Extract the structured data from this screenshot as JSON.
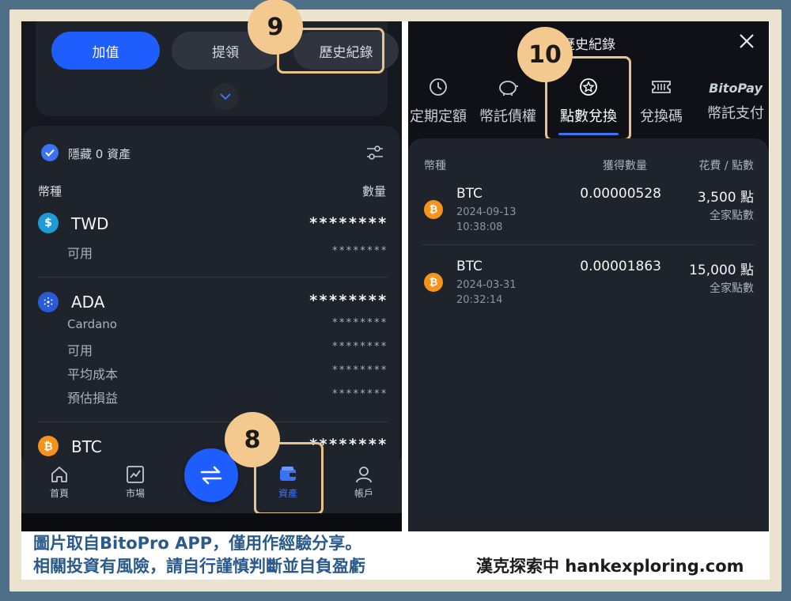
{
  "left_screen": {
    "buttons": {
      "deposit": "加值",
      "withdraw": "提領",
      "history": "歷史紀錄"
    },
    "hide_zero": "隱藏 0 資產",
    "columns": {
      "coin": "幣種",
      "amount": "數量"
    },
    "assets": [
      {
        "symbol": "TWD",
        "icon": "dollar-icon",
        "color": "#1e9bd7",
        "masked": "********",
        "details": [
          {
            "label": "可用",
            "value": "********"
          }
        ]
      },
      {
        "symbol": "ADA",
        "icon": "cardano-icon",
        "color": "#2a5bd7",
        "masked": "********",
        "full_name": "Cardano",
        "details": [
          {
            "label": "可用",
            "value": "********"
          },
          {
            "label": "平均成本",
            "value": "********"
          },
          {
            "label": "預估損益",
            "value": "********"
          }
        ]
      },
      {
        "symbol": "BTC",
        "icon": "bitcoin-icon",
        "color": "#f7931a",
        "masked": "********"
      }
    ],
    "nav": {
      "home": "首頁",
      "market": "市場",
      "assets": "資產",
      "account": "帳戶"
    }
  },
  "right_screen": {
    "title": "歷史紀錄",
    "tabs": [
      "定期定額",
      "幣託債權",
      "點數兌換",
      "兌換碼",
      "幣託支付"
    ],
    "tab_brand": "BitoPay",
    "columns": {
      "coin": "幣種",
      "obtained": "獲得數量",
      "cost": "花費 / 點數"
    },
    "records": [
      {
        "coin": "BTC",
        "date": "2024-09-13",
        "time": "10:38:08",
        "amount": "0.00000528",
        "cost": "3,500 點",
        "source": "全家點數"
      },
      {
        "coin": "BTC",
        "date": "2024-03-31",
        "time": "20:32:14",
        "amount": "0.00001863",
        "cost": "15,000 點",
        "source": "全家點數"
      }
    ]
  },
  "badges": {
    "b8": "8",
    "b9": "9",
    "b10": "10"
  },
  "caption": {
    "line1": "圖片取自BitoPro  APP，僅用作經驗分享。",
    "line2": "相關投資有風險，請自行謹慎判斷並自負盈虧",
    "credit": "漢克探索中 hankexploring.com"
  },
  "colors": {
    "accent": "#1e5eff",
    "highlight": "#e8c48a",
    "badge": "#f3c98f",
    "bitcoin": "#f7931a"
  }
}
